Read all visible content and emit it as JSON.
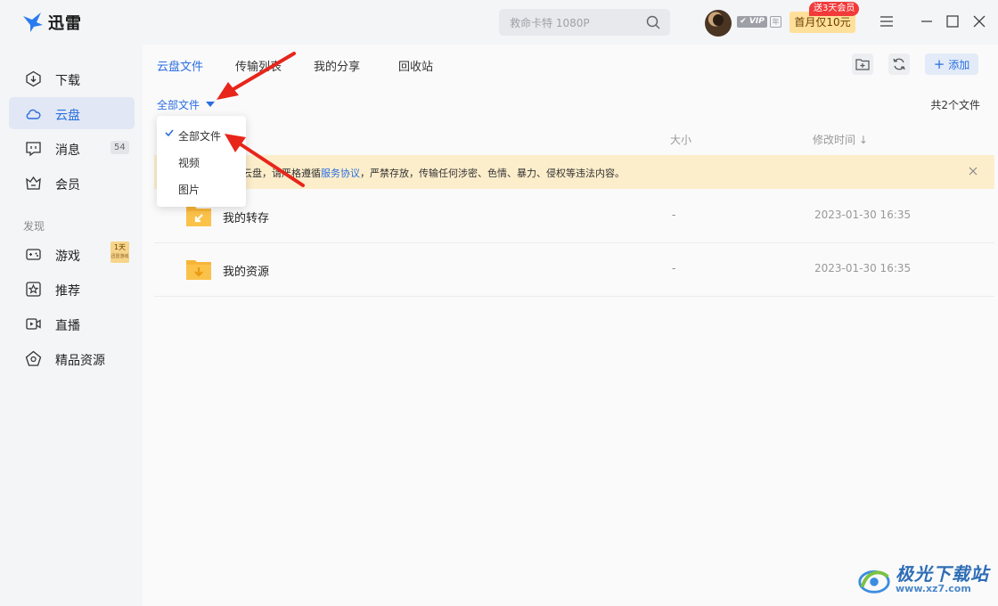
{
  "app": {
    "name": "迅雷"
  },
  "search": {
    "placeholder": "救命卡特 1080P"
  },
  "account": {
    "vip_label": "VIP",
    "year_label": "年",
    "promo_button": "首月仅10元",
    "promo_tag": "送3天会员"
  },
  "sidebar": {
    "items": [
      {
        "label": "下载",
        "icon": "download-icon"
      },
      {
        "label": "云盘",
        "icon": "cloud-icon",
        "active": true
      },
      {
        "label": "消息",
        "icon": "message-icon",
        "count": "54"
      },
      {
        "label": "会员",
        "icon": "crown-icon"
      }
    ],
    "section_label": "发现",
    "discover_items": [
      {
        "label": "游戏",
        "icon": "gamepad-icon",
        "badge_top": "1天",
        "badge_bottom": "迅雷游戏"
      },
      {
        "label": "推荐",
        "icon": "star-icon"
      },
      {
        "label": "直播",
        "icon": "live-icon"
      },
      {
        "label": "精品资源",
        "icon": "gem-icon"
      }
    ]
  },
  "tabs": [
    "云盘文件",
    "传输列表",
    "我的分享",
    "回收站"
  ],
  "toolbar": {
    "add_label": "添加"
  },
  "filter": {
    "current": "全部文件",
    "options": [
      "全部文件",
      "视频",
      "图片"
    ],
    "selected_index": 0
  },
  "file_count": "共2个文件",
  "columns": {
    "size": "大小",
    "modified": "修改时间"
  },
  "notice": {
    "text_start": "人云盘，请严格遵循",
    "link": "服务协议",
    "text_end": "，严禁存放，传输任何涉密、色情、暴力、侵权等违法内容。"
  },
  "files": [
    {
      "name": "我的转存",
      "size": "-",
      "modified": "2023-01-30 16:35"
    },
    {
      "name": "我的资源",
      "size": "-",
      "modified": "2023-01-30 16:35"
    }
  ],
  "watermark": {
    "text": "极光下载站",
    "url": "www.xz7.com"
  },
  "colors": {
    "accent": "#2a6ee0",
    "folder": "#f7b537",
    "notice_bg": "#fdeecb",
    "arrow": "#e8251a"
  }
}
